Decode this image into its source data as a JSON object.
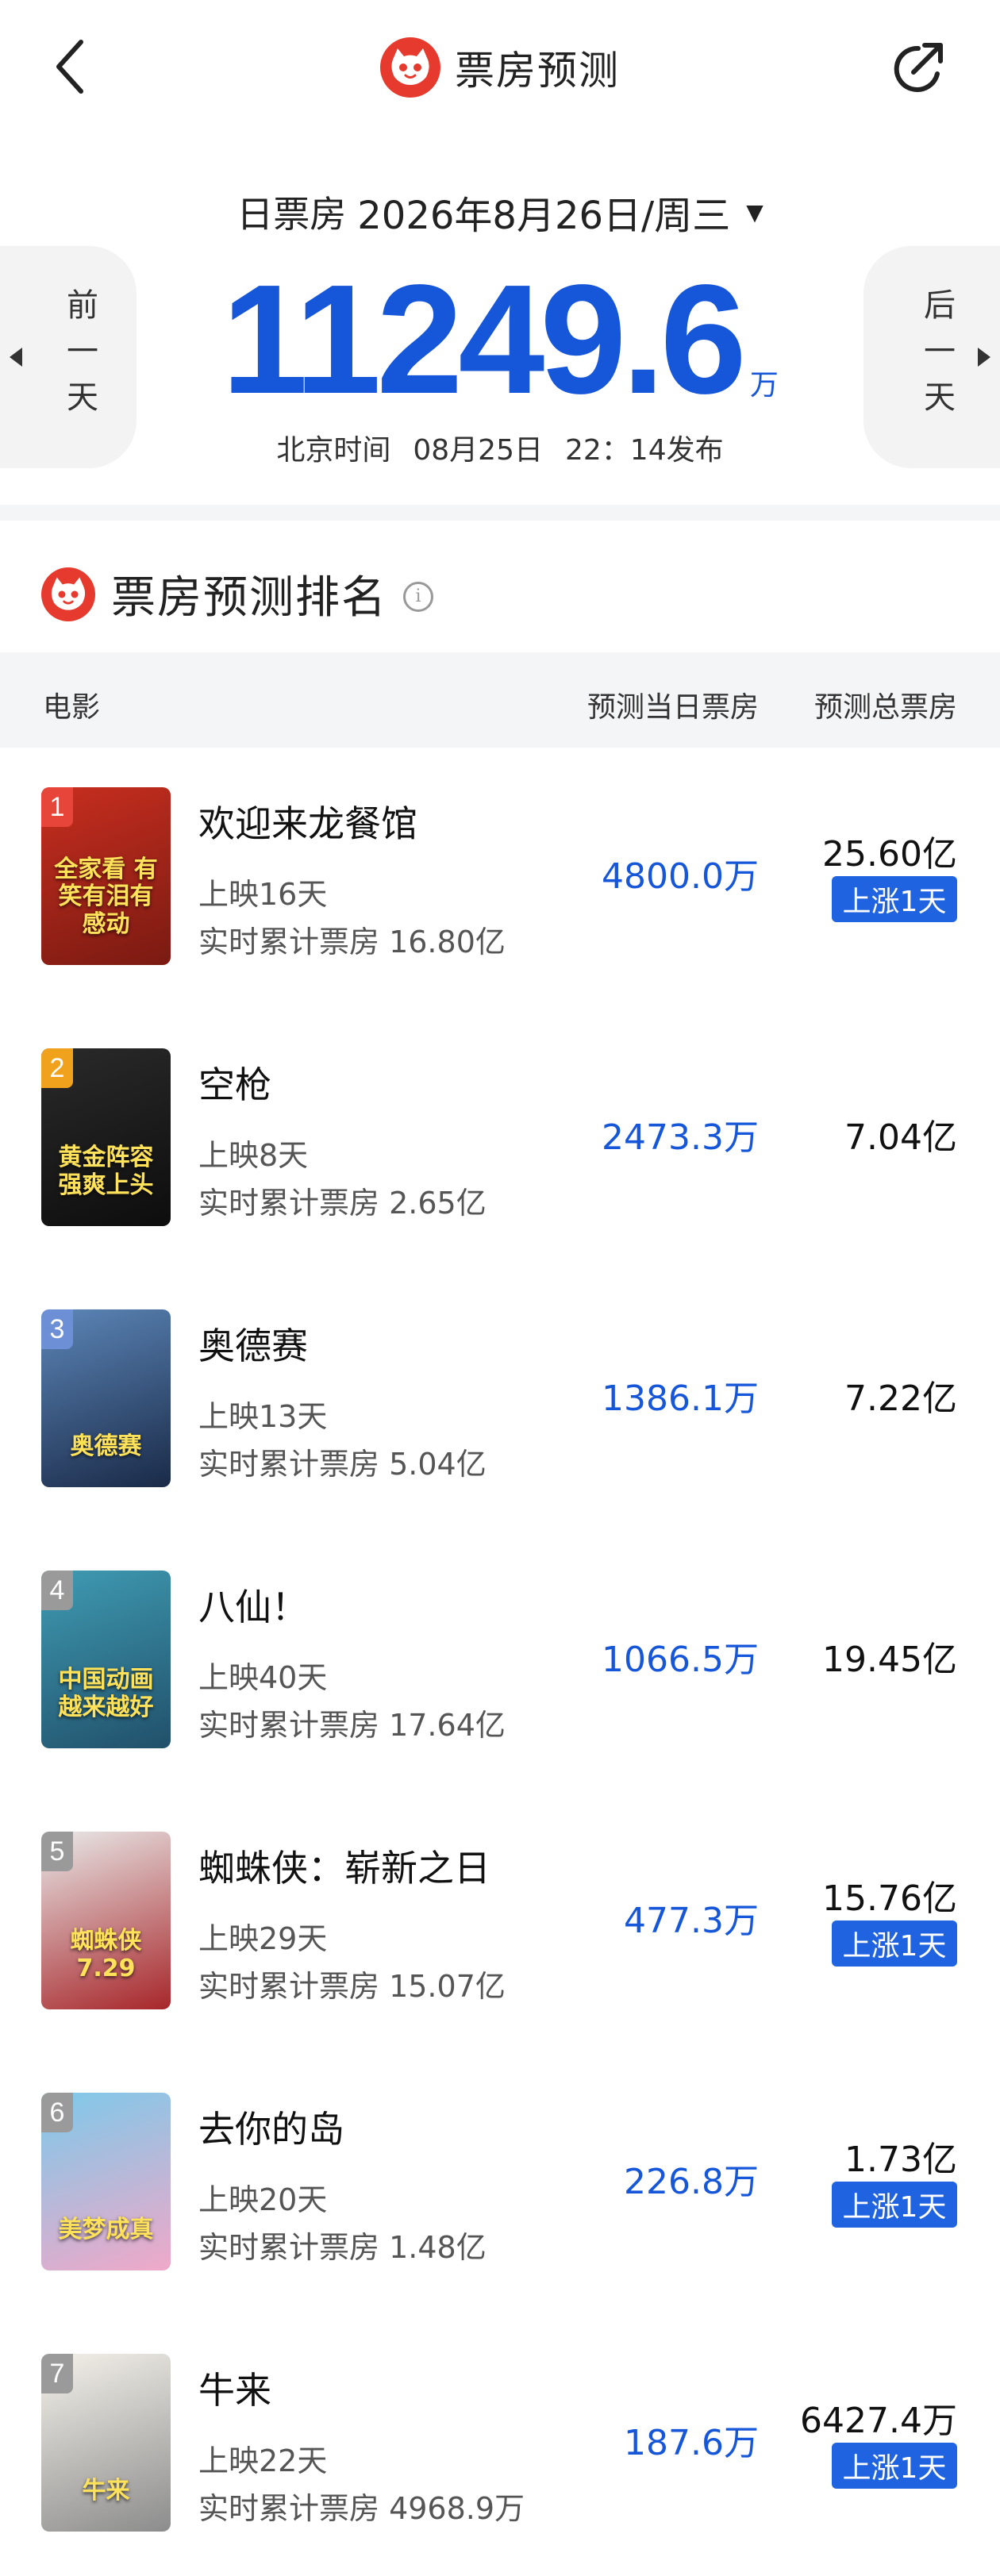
{
  "header": {
    "title": "票房预测",
    "colors": {
      "brand_red": "#e63a2e",
      "accent_blue": "#1656d8",
      "tag_blue": "#1f63e0"
    }
  },
  "summary": {
    "date_label": "日票房",
    "date_value": "2026年8月26日/周三",
    "prev_day": "前一天",
    "next_day": "后一天",
    "total": "11249.6",
    "unit": "万",
    "publish_zone": "北京时间",
    "publish_date": "08月25日",
    "publish_time": "22：14发布"
  },
  "ranking": {
    "title": "票房预测排名",
    "columns": {
      "movie": "电影",
      "day_forecast": "预测当日票房",
      "total_forecast": "预测总票房"
    },
    "movies": [
      {
        "rank": "1",
        "name": "欢迎来龙餐馆",
        "days": "上映16天",
        "cumulative": "实时累计票房 16.80亿",
        "day_forecast": "4800.0万",
        "total_forecast": "25.60亿",
        "tag": "上涨1天",
        "poster_text": "全家看 有笑有泪有感动",
        "poster_colors": [
          "#c72e1f",
          "#7a1a12"
        ],
        "badge_color": "#e8453a"
      },
      {
        "rank": "2",
        "name": "空枪",
        "days": "上映8天",
        "cumulative": "实时累计票房 2.65亿",
        "day_forecast": "2473.3万",
        "total_forecast": "7.04亿",
        "tag": "",
        "poster_text": "黄金阵容 强爽上头",
        "poster_colors": [
          "#2a2a2a",
          "#0d0d0d"
        ],
        "badge_color": "#f0a21c"
      },
      {
        "rank": "3",
        "name": "奥德赛",
        "days": "上映13天",
        "cumulative": "实时累计票房 5.04亿",
        "day_forecast": "1386.1万",
        "total_forecast": "7.22亿",
        "tag": "",
        "poster_text": "奥德赛",
        "poster_colors": [
          "#5c86b8",
          "#1a2a48"
        ],
        "badge_color": "#6d8fd6"
      },
      {
        "rank": "4",
        "name": "八仙！",
        "days": "上映40天",
        "cumulative": "实时累计票房 17.64亿",
        "day_forecast": "1066.5万",
        "total_forecast": "19.45亿",
        "tag": "",
        "poster_text": "中国动画 越来越好",
        "poster_colors": [
          "#3f9bb3",
          "#21506a"
        ],
        "badge_color": "#9a9a9a"
      },
      {
        "rank": "5",
        "name": "蜘蛛侠：崭新之日",
        "days": "上映29天",
        "cumulative": "实时累计票房 15.07亿",
        "day_forecast": "477.3万",
        "total_forecast": "15.76亿",
        "tag": "上涨1天",
        "poster_text": "蜘蛛侠 7.29",
        "poster_colors": [
          "#e9e9e9",
          "#a7262a"
        ],
        "badge_color": "#9a9a9a"
      },
      {
        "rank": "6",
        "name": "去你的岛",
        "days": "上映20天",
        "cumulative": "实时累计票房 1.48亿",
        "day_forecast": "226.8万",
        "total_forecast": "1.73亿",
        "tag": "上涨1天",
        "poster_text": "美梦成真",
        "poster_colors": [
          "#7ec9ea",
          "#f0a8c8"
        ],
        "badge_color": "#9a9a9a"
      },
      {
        "rank": "7",
        "name": "牛来",
        "days": "上映22天",
        "cumulative": "实时累计票房 4968.9万",
        "day_forecast": "187.6万",
        "total_forecast": "6427.4万",
        "tag": "上涨1天",
        "poster_text": "牛来",
        "poster_colors": [
          "#f4f1ea",
          "#8c8c8c"
        ],
        "badge_color": "#9a9a9a"
      }
    ]
  }
}
